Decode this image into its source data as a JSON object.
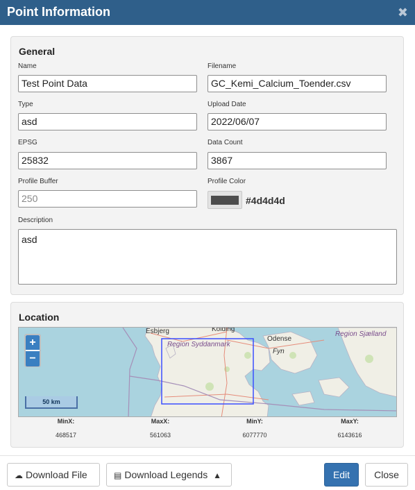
{
  "dialog": {
    "title": "Point Information"
  },
  "general": {
    "section_title": "General",
    "name": {
      "label": "Name",
      "value": "Test Point Data"
    },
    "filename": {
      "label": "Filename",
      "value": "GC_Kemi_Calcium_Toender.csv"
    },
    "type": {
      "label": "Type",
      "value": "asd"
    },
    "upload_date": {
      "label": "Upload Date",
      "value": "2022/06/07"
    },
    "epsg": {
      "label": "EPSG",
      "value": "25832"
    },
    "data_count": {
      "label": "Data Count",
      "value": "3867"
    },
    "profile_buffer": {
      "label": "Profile Buffer",
      "placeholder": "250"
    },
    "profile_color": {
      "label": "Profile Color",
      "value": "#4d4d4d"
    },
    "description": {
      "label": "Description",
      "value": "asd"
    }
  },
  "location": {
    "section_title": "Location",
    "map": {
      "zoom_in": "+",
      "zoom_out": "−",
      "scale": "50 km",
      "labels": {
        "esbjerg": "Esbjerg",
        "kolding": "Kolding",
        "odense": "Odense",
        "fyn": "Fyn",
        "region_syddanmark": "Region Syddanmark",
        "region_sjaelland": "Region Sjælland"
      },
      "extent_color": "#3b4fff"
    },
    "bounds": {
      "minx_label": "MinX:",
      "minx": "468517",
      "maxx_label": "MaxX:",
      "maxx": "561063",
      "miny_label": "MinY:",
      "miny": "6077770",
      "maxy_label": "MaxY:",
      "maxy": "6143616"
    }
  },
  "footer": {
    "download_file": "Download File",
    "download_legends": "Download Legends",
    "edit": "Edit",
    "close": "Close"
  },
  "colors": {
    "header": "#2f5f8a",
    "primary": "#3572b0"
  },
  "icons": [
    "close-icon",
    "cloud-download-icon",
    "files-icon",
    "chevron-up-icon"
  ]
}
